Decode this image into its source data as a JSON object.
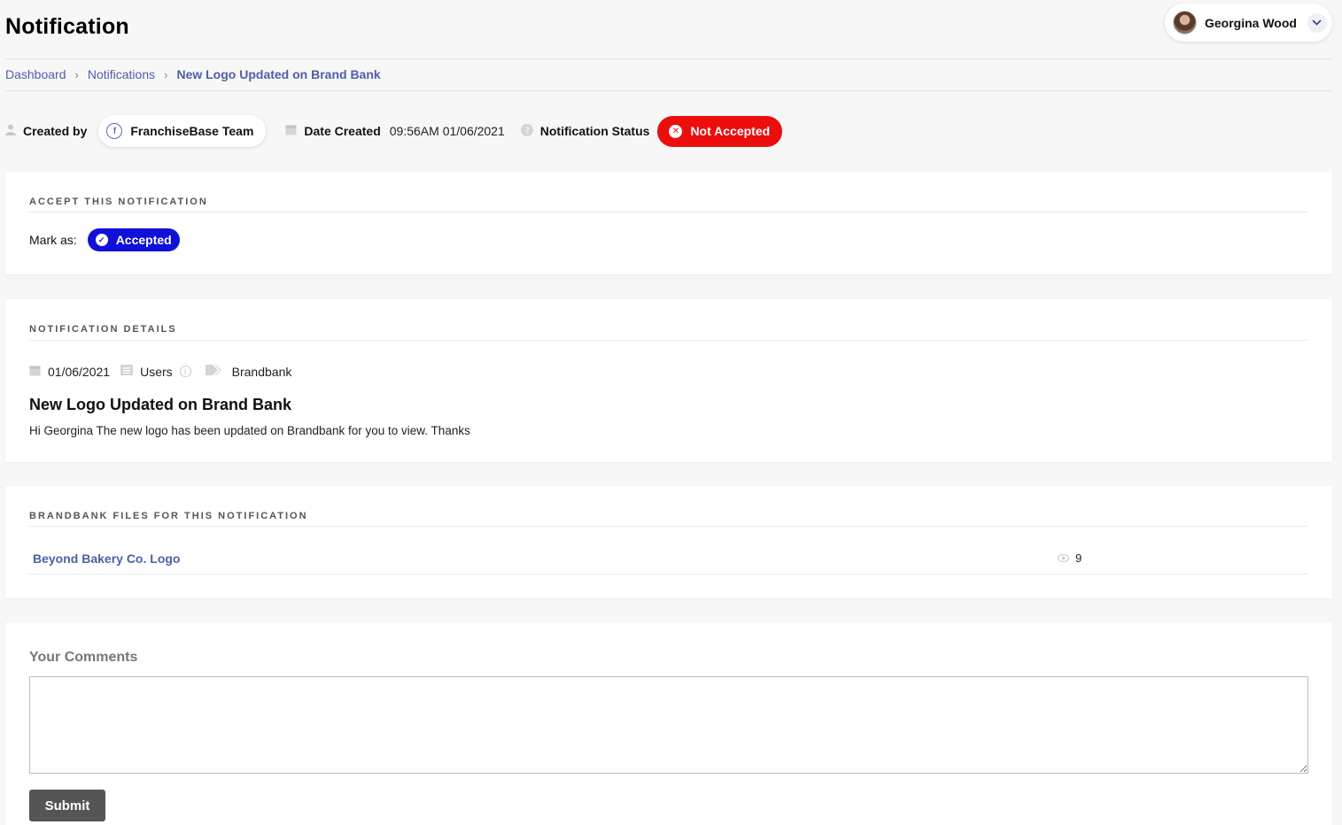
{
  "header": {
    "title": "Notification",
    "user": {
      "name": "Georgina Wood"
    }
  },
  "breadcrumb": [
    "Dashboard",
    "Notifications",
    "New Logo Updated on Brand Bank"
  ],
  "meta": {
    "created_by_label": "Created by",
    "creator": "FranchiseBase Team",
    "date_created_label": "Date Created",
    "date_created_value": "09:56AM 01/06/2021",
    "status_label": "Notification Status",
    "status_value": "Not Accepted",
    "status_color": "#ec0d0d"
  },
  "accept_card": {
    "heading": "ACCEPT THIS NOTIFICATION",
    "mark_as_label": "Mark as:",
    "accepted_button": "Accepted",
    "button_color": "#1010d8"
  },
  "details_card": {
    "heading": "NOTIFICATION DETAILS",
    "date": "01/06/2021",
    "audience": "Users",
    "tag": "Brandbank",
    "title": "New Logo Updated on Brand Bank",
    "body": "Hi Georgina The new logo has been updated on Brandbank for you to view. Thanks"
  },
  "files_card": {
    "heading": "BRANDBANK FILES FOR THIS NOTIFICATION",
    "files": [
      {
        "name": "Beyond Bakery Co. Logo",
        "views": "9"
      }
    ]
  },
  "comments_card": {
    "title": "Your Comments",
    "textarea_value": "",
    "submit_label": "Submit"
  },
  "icons": {
    "user": "user-icon",
    "calendar": "calendar-icon",
    "question": "question-circle-icon",
    "list": "list-icon",
    "info": "info-icon",
    "tag": "tag-icon",
    "eye": "eye-icon"
  },
  "colors": {
    "link": "#4c5fa8",
    "background": "#f7f7f7"
  }
}
